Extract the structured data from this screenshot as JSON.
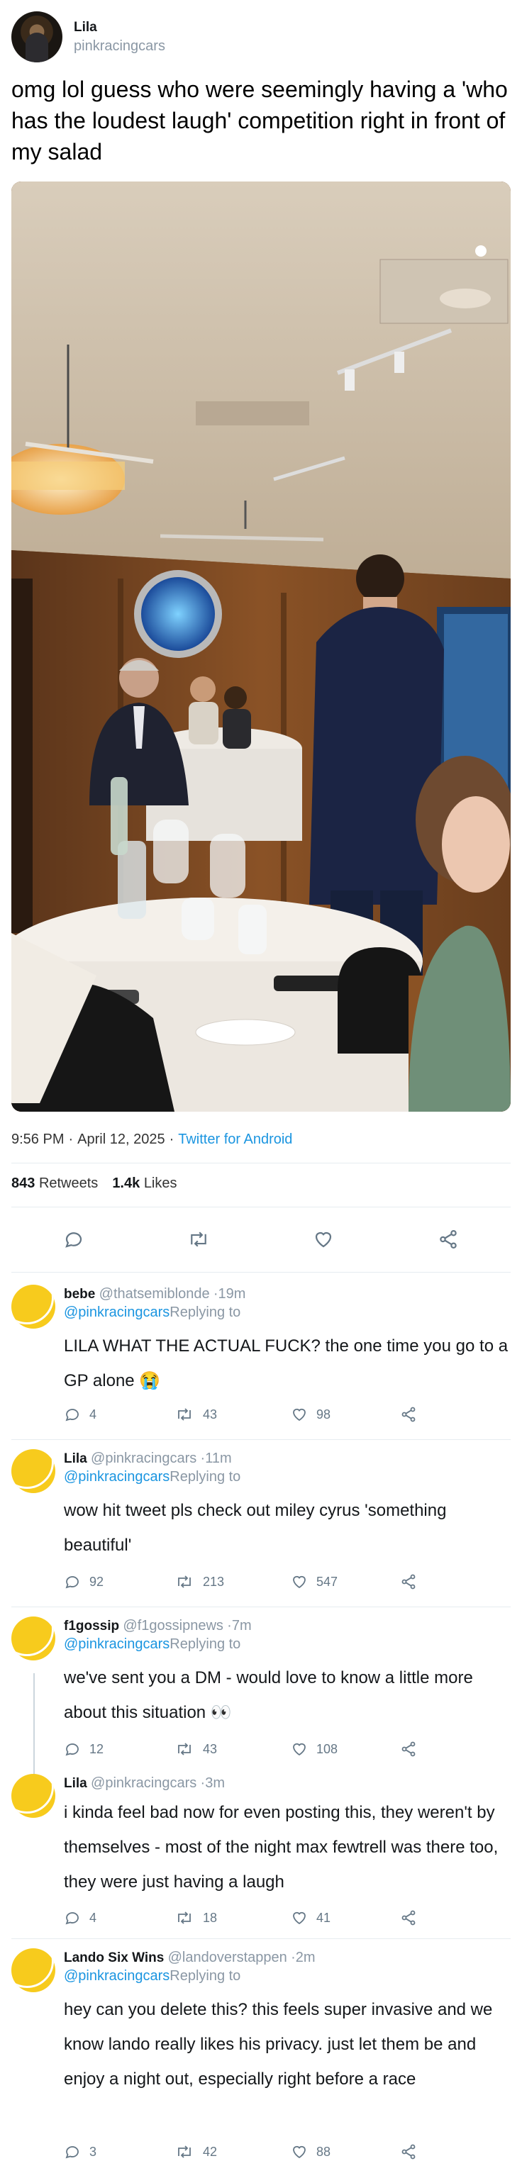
{
  "tweet": {
    "display_name": "Lila",
    "handle": "pinkracingcars",
    "text": "omg lol guess who were seemingly having a 'who has the loudest laugh' competition right in front of my salad",
    "time": "9:56 PM",
    "date": "April 12, 2025",
    "separator": "·",
    "source": "Twitter for Android",
    "retweets_count": "843",
    "retweets_label": "Retweets",
    "likes_count": "1.4k",
    "likes_label": "Likes"
  },
  "icons": {
    "reply": "reply-icon",
    "retweet": "retweet-icon",
    "like": "heart-icon",
    "share": "share-icon"
  },
  "colors": {
    "link": "#1b95e0",
    "muted": "#8a97a4",
    "avatar_yellow": "#f7cb1d",
    "divider": "#e6ecf0"
  },
  "replies": [
    {
      "name": "bebe",
      "handle": "@thatsemiblonde",
      "time": "·19m",
      "mention": "@pinkracingcars",
      "replying_to": "Replying to",
      "text": "LILA WHAT THE ACTUAL FUCK? the one time you go to a GP alone 😭",
      "replies": "4",
      "retweets": "43",
      "likes": "98"
    },
    {
      "name": "Lila",
      "handle": "@pinkracingcars",
      "time": "·11m",
      "mention": "@pinkracingcars",
      "replying_to": "Replying to",
      "text": "wow hit tweet pls check out miley cyrus 'something beautiful'",
      "replies": "92",
      "retweets": "213",
      "likes": "547"
    },
    {
      "name": "f1gossip",
      "handle": "@f1gossipnews",
      "time": "·7m",
      "mention": "@pinkracingcars",
      "replying_to": "Replying to",
      "text": "we've sent you a DM - would love to know a little more about this situation 👀",
      "replies": "12",
      "retweets": "43",
      "likes": "108"
    },
    {
      "name": "Lila",
      "handle": "@pinkracingcars",
      "time": "·3m",
      "text": "i kinda feel bad now for even posting this, they weren't by themselves - most of the night max fewtrell was there too, they were just having a laugh",
      "replies": "4",
      "retweets": "18",
      "likes": "41"
    },
    {
      "name": "Lando Six Wins",
      "handle": "@landoverstappen",
      "time": "·2m",
      "mention": "@pinkracingcars",
      "replying_to": "Replying to",
      "text": "hey can you delete this? this feels super invasive and we know lando really likes his privacy. just let them be and enjoy a night out, especially right before a race",
      "replies": "3",
      "retweets": "42",
      "likes": "88"
    }
  ]
}
